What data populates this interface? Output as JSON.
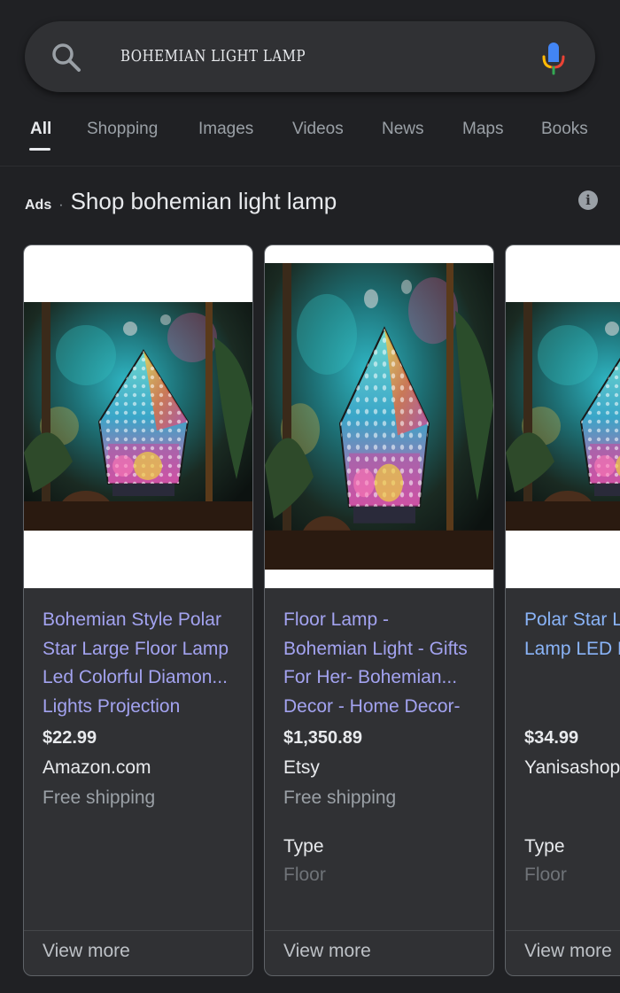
{
  "search": {
    "query": "Bohemian light lamp",
    "search_icon": "search-icon",
    "mic_icon": "microphone-icon"
  },
  "tabs": [
    {
      "label": "All",
      "active": true
    },
    {
      "label": "Shopping"
    },
    {
      "label": "Images"
    },
    {
      "label": "Videos"
    },
    {
      "label": "News"
    },
    {
      "label": "Maps"
    },
    {
      "label": "Books"
    }
  ],
  "ads": {
    "label": "Ads",
    "separator": "·",
    "title": "Shop bohemian light lamp",
    "info_icon": "info-icon",
    "info_glyph": "i"
  },
  "products": [
    {
      "title": "Bohemian Style Polar\nStar Large Floor Lamp\nLed Colorful Diamon...\nLights Projection",
      "price": "$22.99",
      "seller": "Amazon.com",
      "shipping": "Free shipping",
      "view_more": "View more"
    },
    {
      "title": "Floor Lamp -\nBohemian Light - Gifts\nFor Her- Bohemian...\nDecor - Home Decor-",
      "price": "$1,350.89",
      "seller": "Etsy",
      "shipping": "Free shipping",
      "attr_label": "Type",
      "attr_value": "Floor",
      "view_more": "View more"
    },
    {
      "title": "Polar Star L\nLamp LED F",
      "price": "$34.99",
      "seller": "Yanisashop",
      "attr_label": "Type",
      "attr_value": "Floor",
      "view_more": "View more"
    }
  ],
  "colors": {
    "background": "#202124",
    "surface": "#303134",
    "link": "#8ab4f8",
    "link_visited": "#a3a3f0",
    "text_secondary": "#9aa0a6"
  }
}
